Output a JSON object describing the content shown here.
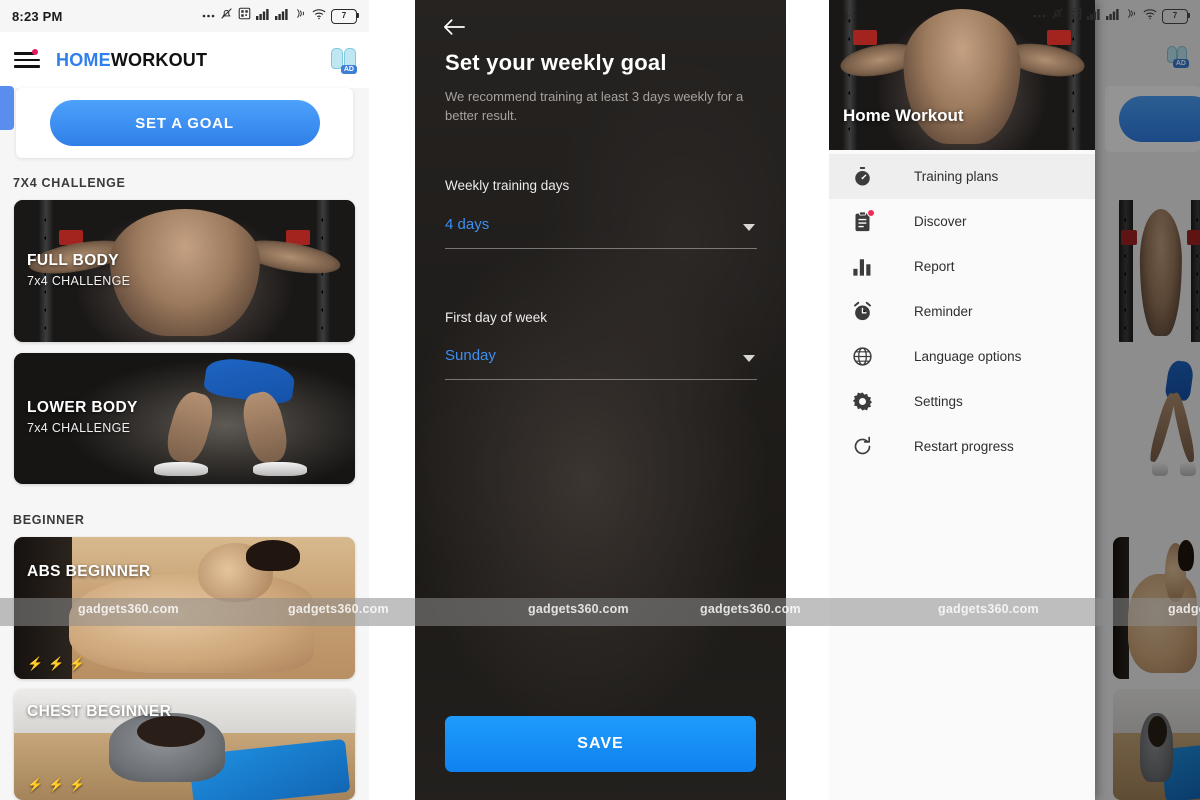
{
  "status_bar": {
    "time": "8:23 PM",
    "battery_level": "7",
    "icons": [
      "more-dots-icon",
      "mute-bell-icon",
      "screenshot-icon",
      "signal-bars-icon",
      "signal-bars-2-icon",
      "nfc-icon",
      "wifi-icon",
      "battery-icon"
    ]
  },
  "home": {
    "brand_primary": "HOME",
    "brand_secondary": "WORKOUT",
    "menu_icon": "hamburger-menu-icon",
    "ad_icon": "ad-earbuds-icon",
    "ad_label": "AD",
    "set_goal_button": "SET A GOAL",
    "sections": [
      {
        "title": "7X4 CHALLENGE",
        "cards": [
          {
            "title": "FULL BODY",
            "subtitle": "7x4 CHALLENGE",
            "art": "gym"
          },
          {
            "title": "LOWER BODY",
            "subtitle": "7x4 CHALLENGE",
            "art": "lower"
          }
        ]
      },
      {
        "title": "BEGINNER",
        "cards": [
          {
            "title": "ABS BEGINNER",
            "subtitle": "",
            "art": "abs",
            "difficulty": 1,
            "difficulty_max": 3
          },
          {
            "title": "CHEST BEGINNER",
            "subtitle": "",
            "art": "chest",
            "difficulty": 1,
            "difficulty_max": 3
          }
        ]
      }
    ]
  },
  "weekly_goal": {
    "back_icon": "back-arrow-icon",
    "title": "Set your weekly goal",
    "subtitle": "We recommend training at least 3 days weekly for a better result.",
    "fields": [
      {
        "label": "Weekly training days",
        "value": "4 days",
        "caret_icon": "chevron-down-icon"
      },
      {
        "label": "First day of week",
        "value": "Sunday",
        "caret_icon": "chevron-down-icon"
      }
    ],
    "save_button": "SAVE"
  },
  "drawer": {
    "header_title": "Home Workout",
    "items": [
      {
        "label": "Training plans",
        "icon": "stopwatch-icon",
        "selected": true,
        "badge": false
      },
      {
        "label": "Discover",
        "icon": "clipboard-icon",
        "selected": false,
        "badge": true
      },
      {
        "label": "Report",
        "icon": "bar-chart-icon",
        "selected": false,
        "badge": false
      },
      {
        "label": "Reminder",
        "icon": "alarm-clock-icon",
        "selected": false,
        "badge": false
      },
      {
        "label": "Language options",
        "icon": "globe-icon",
        "selected": false,
        "badge": false
      },
      {
        "label": "Settings",
        "icon": "gear-icon",
        "selected": false,
        "badge": false
      },
      {
        "label": "Restart progress",
        "icon": "refresh-icon",
        "selected": false,
        "badge": false
      }
    ]
  },
  "watermark": {
    "text": "gadgets360.com",
    "positions_x": [
      78,
      288,
      528,
      700,
      938,
      1168
    ]
  },
  "colors": {
    "accent_blue": "#2f80ed",
    "button_blue": "#1e9bfb",
    "link_blue": "#3d8ff0",
    "badge_red": "#ef2d56",
    "drawer_bg": "#fafafa",
    "selected_row": "#eeeeee",
    "panel2_bg": "#2d2a29"
  }
}
